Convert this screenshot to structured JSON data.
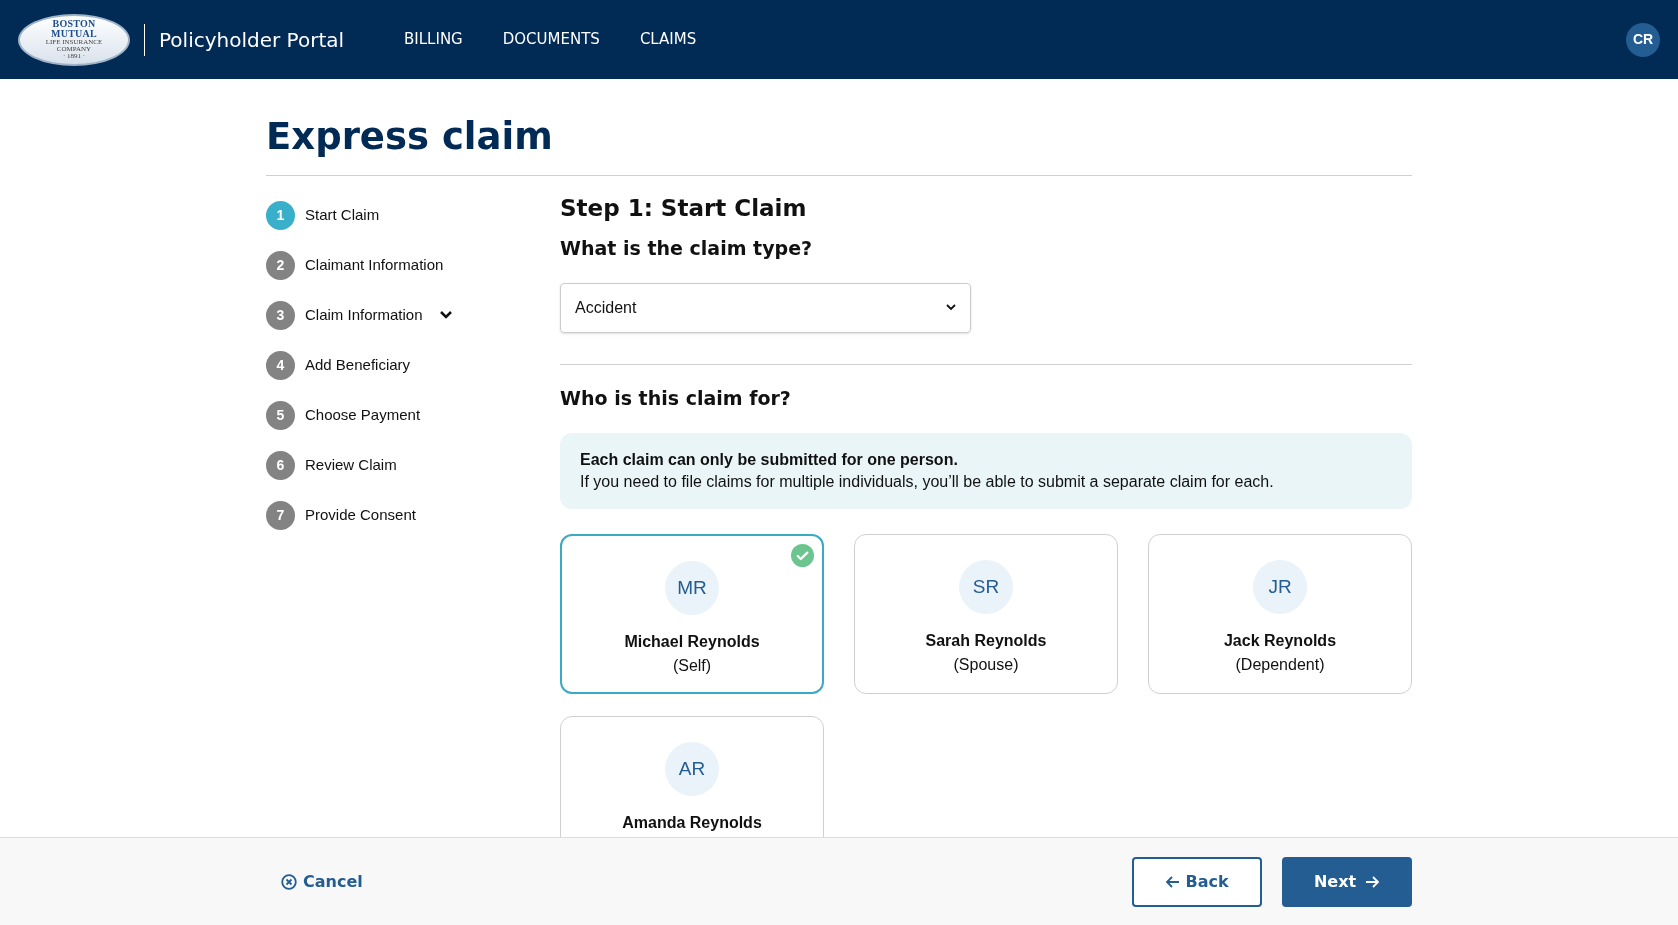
{
  "header": {
    "logo_lines": [
      "BOSTON",
      "MUTUAL",
      "LIFE INSURANCE",
      "COMPANY",
      "· 1891 ·"
    ],
    "portal_title": "Policyholder Portal",
    "nav": [
      {
        "label": "BILLING",
        "selected": false
      },
      {
        "label": "DOCUMENTS",
        "selected": false
      },
      {
        "label": "CLAIMS",
        "selected": false
      }
    ],
    "user_initials": "CR"
  },
  "page_title": "Express claim",
  "steps": [
    {
      "number": "1",
      "label": "Start Claim",
      "selected": true,
      "expandable": false
    },
    {
      "number": "2",
      "label": "Claimant Information",
      "selected": false,
      "expandable": false
    },
    {
      "number": "3",
      "label": "Claim Information",
      "selected": false,
      "expandable": true
    },
    {
      "number": "4",
      "label": "Add Beneficiary",
      "selected": false,
      "expandable": false
    },
    {
      "number": "5",
      "label": "Choose Payment",
      "selected": false,
      "expandable": false
    },
    {
      "number": "6",
      "label": "Review Claim",
      "selected": false,
      "expandable": false
    },
    {
      "number": "7",
      "label": "Provide Consent",
      "selected": false,
      "expandable": false
    }
  ],
  "step_title": "Step 1: Start Claim",
  "claim_type": {
    "question": "What is the claim type?",
    "value": "Accident"
  },
  "claimant": {
    "question": "Who is this claim for?",
    "notice_title": "Each claim can only be submitted for one person.",
    "notice_text": "If you need to file claims for multiple individuals, you’ll be able to submit a separate claim for each.",
    "people": [
      {
        "initials": "MR",
        "name": "Michael Reynolds",
        "relation": "(Self)",
        "selected": true
      },
      {
        "initials": "SR",
        "name": "Sarah Reynolds",
        "relation": "(Spouse)",
        "selected": false
      },
      {
        "initials": "JR",
        "name": "Jack Reynolds",
        "relation": "(Dependent)",
        "selected": false
      },
      {
        "initials": "AR",
        "name": "Amanda Reynolds",
        "selected": false
      }
    ]
  },
  "footer": {
    "cancel": "Cancel",
    "back": "Back",
    "next": "Next"
  }
}
